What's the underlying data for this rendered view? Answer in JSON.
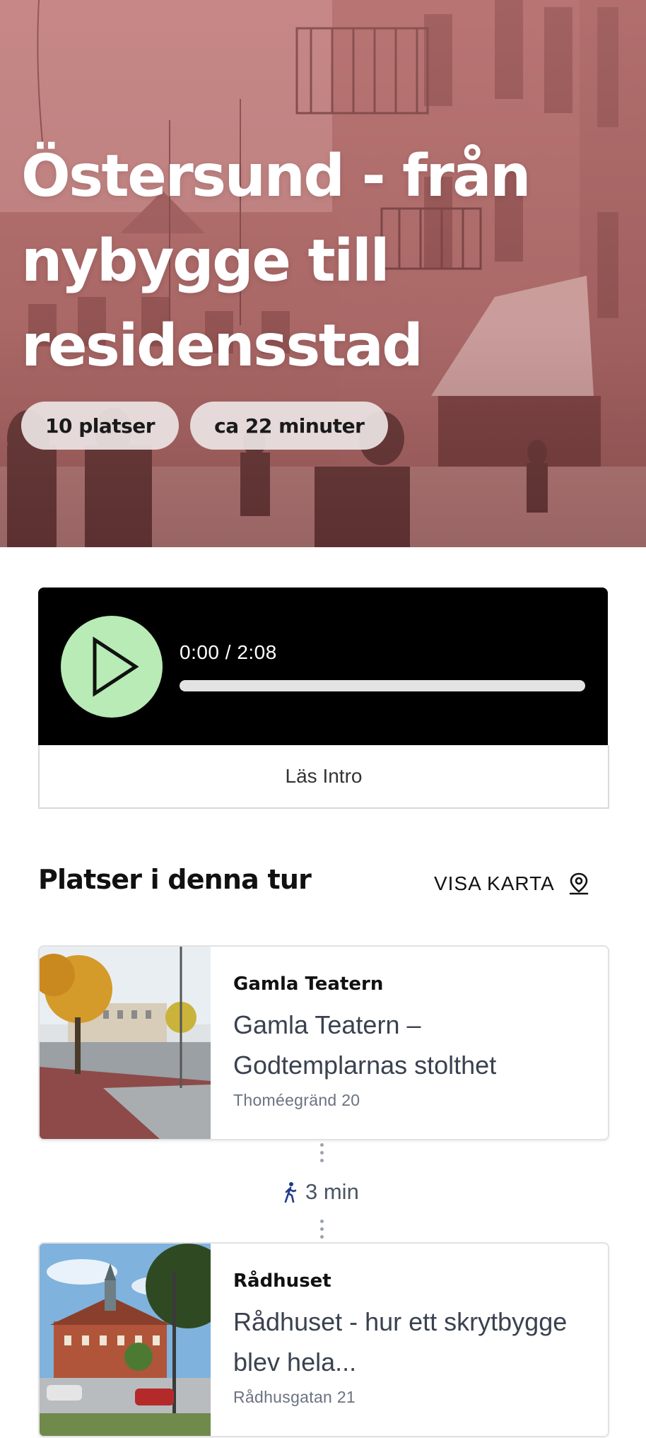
{
  "hero": {
    "title": "Östersund - från nybygge till residensstad",
    "chips": [
      "10 platser",
      "ca 22 minuter"
    ]
  },
  "player": {
    "time": "0:00 / 2:08",
    "progress": 0,
    "play_icon": "play-icon",
    "read_intro_label": "Läs Intro"
  },
  "section": {
    "title": "Platser i denna tur",
    "map_label": "VISA KARTA",
    "map_icon": "map-pin-icon"
  },
  "places": [
    {
      "name": "Gamla Teatern",
      "title": "Gamla Teatern – Godtemplarnas stolthet",
      "address": "Thoméegränd 20"
    },
    {
      "name": "Rådhuset",
      "title": "Rådhuset - hur ett skrytbygge blev hela...",
      "address": "Rådhusgatan 21"
    }
  ],
  "walk": {
    "label": "3 min",
    "icon": "walking-person-icon"
  },
  "colors": {
    "accent_green": "#b8ebb5",
    "hero_tint": "#c47878",
    "player_bg": "#000000"
  }
}
